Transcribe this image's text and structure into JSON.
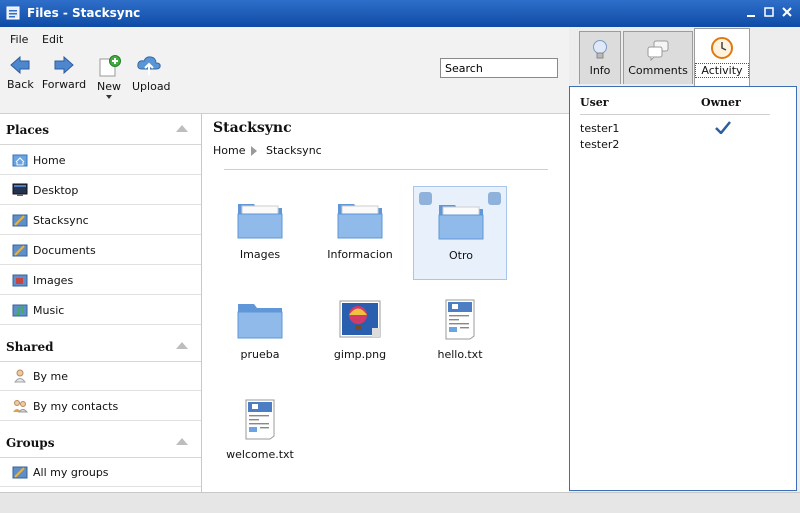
{
  "window": {
    "title": "Files - Stacksync"
  },
  "menu": [
    "File",
    "Edit"
  ],
  "toolbar": {
    "back": "Back",
    "forward": "Forward",
    "new": "New",
    "upload": "Upload",
    "search_value": "Search"
  },
  "sidebar": {
    "places_title": "Places",
    "places": [
      "Home",
      "Desktop",
      "Stacksync",
      "Documents",
      "Images",
      "Music"
    ],
    "shared_title": "Shared",
    "shared": [
      "By me",
      "By my contacts"
    ],
    "groups_title": "Groups",
    "groups": [
      "All my groups"
    ]
  },
  "main": {
    "title": "Stacksync",
    "breadcrumb": [
      "Home",
      "Stacksync"
    ],
    "files": [
      {
        "name": "Images",
        "kind": "folder"
      },
      {
        "name": "Informacion",
        "kind": "folder"
      },
      {
        "name": "Otro",
        "kind": "folder",
        "selected": true
      },
      {
        "name": "prueba",
        "kind": "folder-empty"
      },
      {
        "name": "gimp.png",
        "kind": "image"
      },
      {
        "name": "hello.txt",
        "kind": "text"
      },
      {
        "name": "welcome.txt",
        "kind": "text"
      }
    ]
  },
  "tabs": [
    {
      "label": "Info",
      "icon": "lightbulb-icon"
    },
    {
      "label": "Comments",
      "icon": "speech-bubbles-icon"
    },
    {
      "label": "Activity",
      "icon": "clock-icon",
      "active": true
    }
  ],
  "panel": {
    "col_user": "User",
    "col_owner": "Owner",
    "rows": [
      {
        "user": "tester1",
        "owner": true
      },
      {
        "user": "tester2",
        "owner": false
      }
    ]
  },
  "colors": {
    "titlebar": "#0f4ba6",
    "folder": "#6aa4e2",
    "selection": "#e8f1fb"
  }
}
